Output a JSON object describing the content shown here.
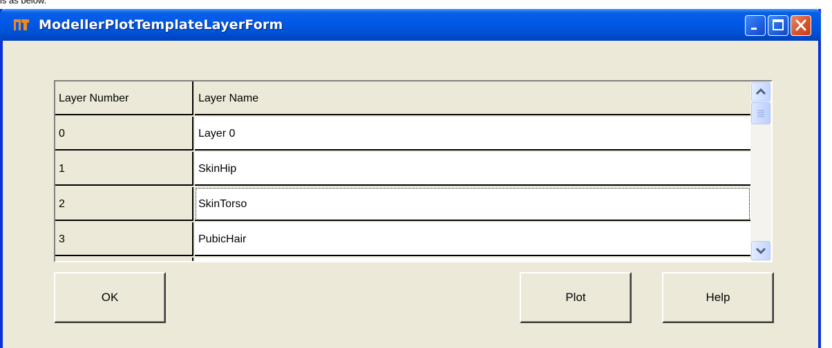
{
  "caption_snippet": "is as below.",
  "window": {
    "title": "ModellerPlotTemplateLayerForm",
    "icon": "app-icon",
    "controls": [
      "minimize-icon",
      "maximize-icon",
      "close-icon"
    ]
  },
  "grid": {
    "columns": [
      "Layer Number",
      "Layer Name"
    ],
    "rows": [
      {
        "number": "0",
        "name": "Layer 0"
      },
      {
        "number": "1",
        "name": "SkinHip"
      },
      {
        "number": "2",
        "name": "SkinTorso"
      },
      {
        "number": "3",
        "name": "PubicHair"
      }
    ],
    "focused_row": 2
  },
  "buttons": {
    "ok": "OK",
    "plot": "Plot",
    "help": "Help"
  },
  "colors": {
    "titlebar": "#0058e6",
    "window_bg": "#ece9d8",
    "close_button": "#d9542b"
  }
}
